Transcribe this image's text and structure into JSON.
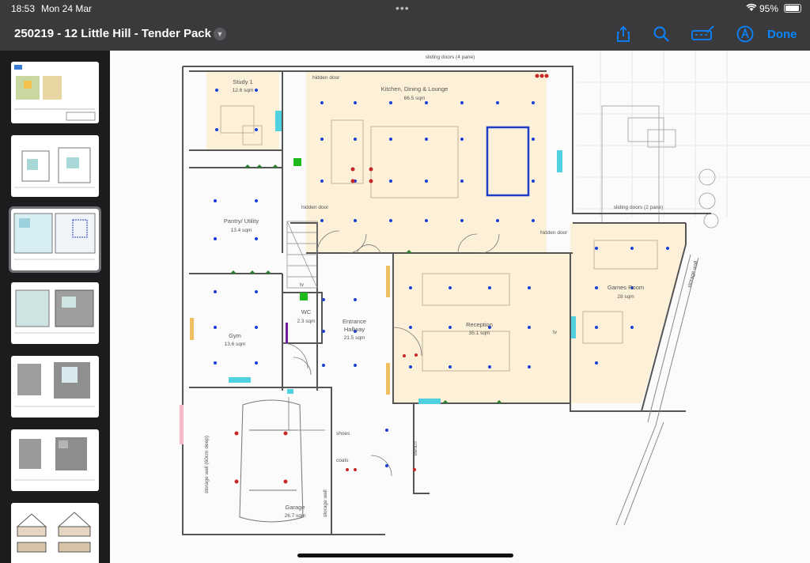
{
  "status": {
    "time": "18:53",
    "date": "Mon 24 Mar",
    "battery": "95%"
  },
  "toolbar": {
    "title": "250219 - 12 Little Hill - Tender Pack",
    "icons": [
      "share-icon",
      "search-icon",
      "markup-icon",
      "pencil-tip-icon"
    ],
    "done_label": "Done",
    "accent": "#0a84ff"
  },
  "thumbnails": [
    {
      "page": 1,
      "selected": false
    },
    {
      "page": 2,
      "selected": false
    },
    {
      "page": 3,
      "selected": true
    },
    {
      "page": 4,
      "selected": false
    },
    {
      "page": 5,
      "selected": false
    },
    {
      "page": 6,
      "selected": false
    },
    {
      "page": 7,
      "selected": false
    }
  ],
  "plan": {
    "top_label": "sliding doors (4 pane)",
    "mid_label": "sliding doors (2 pane)",
    "rooms": [
      {
        "key": "study",
        "name": "Study 1",
        "area": "12.6 sqm"
      },
      {
        "key": "kitchen",
        "name": "Kitchen, Dining & Lounge",
        "area": "66.5 sqm"
      },
      {
        "key": "pantry",
        "name": "Pantry/ Utility",
        "area": "13.4 sqm"
      },
      {
        "key": "gym",
        "name": "Gym",
        "area": "13.6 sqm"
      },
      {
        "key": "wc",
        "name": "WC",
        "area": "2.3 sqm"
      },
      {
        "key": "hallway",
        "name": "Entrance",
        "name2": "Hallway",
        "area": "21.5 sqm"
      },
      {
        "key": "reception",
        "name": "Reception",
        "area": "35.1 sqm"
      },
      {
        "key": "games",
        "name": "Games Room",
        "area": "28 sqm"
      },
      {
        "key": "garage",
        "name": "Garage",
        "area": "26.7 sqm"
      }
    ],
    "annotations": {
      "hidden_door_1": "hidden door",
      "hidden_door_2": "hidden door",
      "hidden_door_3": "hidden door",
      "storage_wall_garage": "storage wall (60cm deep)",
      "storage_wall_right": "storage wall",
      "storage_wall_outer": "storage wall",
      "shoes": "shoes",
      "coats": "coats",
      "bench": "bench",
      "tv": "tv"
    },
    "colors": {
      "room_fill": "#fcf0d8",
      "wall": "#555555",
      "downlight": "#1a3fd6",
      "socket": "#c62828",
      "switch_green": "#2e7d32",
      "feature": "#1e3ec9"
    }
  }
}
